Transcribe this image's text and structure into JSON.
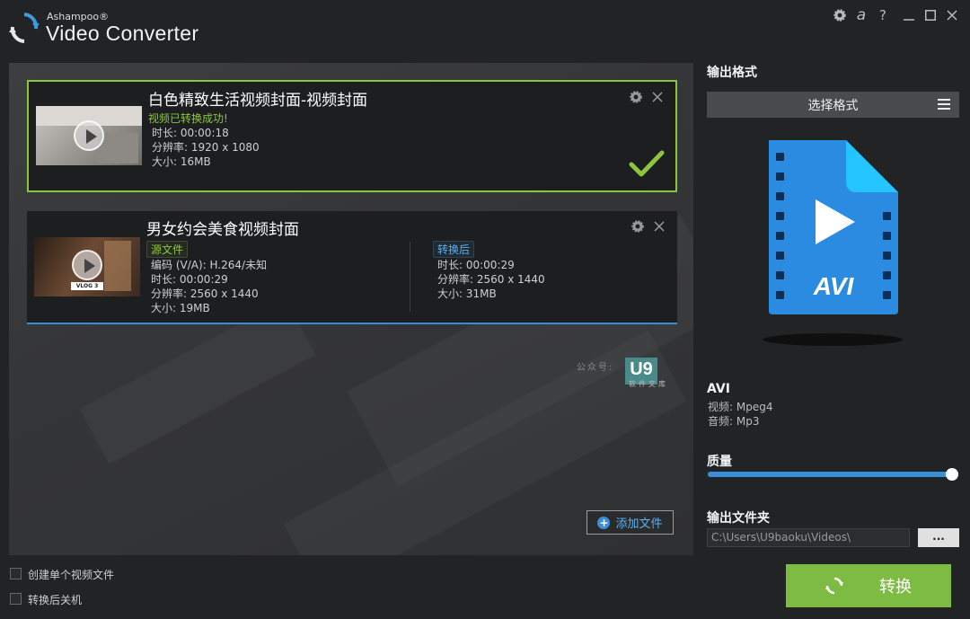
{
  "header": {
    "brand": "Ashampoo®",
    "title": "Video Converter",
    "controls": [
      "settings-icon",
      "ashampoo-a-icon",
      "help-icon",
      "minimize-icon",
      "maximize-icon",
      "close-icon"
    ],
    "glyphs": {
      "a": "a",
      "help": "?"
    }
  },
  "files": [
    {
      "title": "白色精致生活视频封面-视频封面",
      "status": "视频已转换成功!",
      "duration": "时长: 00:00:18",
      "resolution": "分辨率: 1920 x 1080",
      "size": "大小: 16MB"
    },
    {
      "title": "男女约会美食视频封面",
      "thumb_text": "VLOG 3",
      "source_tag": "源文件",
      "source": {
        "codec": "编码 (V/A): H.264/未知",
        "duration": "时长: 00:00:29",
        "resolution": "分辨率: 2560 x 1440",
        "size": "大小: 19MB"
      },
      "target_tag": "转换后",
      "target": {
        "duration": "时长: 00:00:29",
        "resolution": "分辨率: 2560 x 1440",
        "size": "大小: 31MB"
      }
    }
  ],
  "watermark": {
    "prefix": "公众号:",
    "box": "U9",
    "sub": "软件文库"
  },
  "add_files_label": "添加文件",
  "options": {
    "single_file": "创建单个视频文件",
    "shutdown": "转换后关机"
  },
  "convert_label": "转换",
  "right_panel": {
    "output_format_heading": "输出格式",
    "select_format_label": "选择格式",
    "format_icon_text": "AVI",
    "format_name": "AVI",
    "video_codec": "视频: Mpeg4",
    "audio_codec": "音频: Mp3",
    "quality_heading": "质量",
    "quality_level": 1.0,
    "output_folder_heading": "输出文件夹",
    "output_folder": "C:\\Users\\U9baoku\\Videos\\",
    "browse_label": "..."
  },
  "colors": {
    "accent_green": "#8cc63f",
    "accent_blue": "#3a8fd8",
    "convert_green": "#7dbb42",
    "avi_blue": "#2b8be0"
  }
}
